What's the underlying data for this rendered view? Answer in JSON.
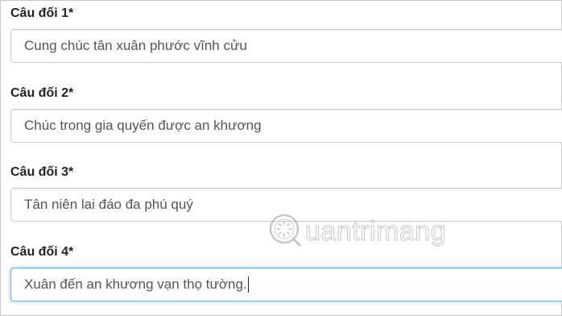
{
  "fields": [
    {
      "label": "Câu đối 1*",
      "value": "Cung chúc tân xuân phước vĩnh cửu"
    },
    {
      "label": "Câu đối 2*",
      "value": "Chúc trong gia quyến được an khương"
    },
    {
      "label": "Câu đối 3*",
      "value": "Tân niên lai đáo đa phú quý"
    },
    {
      "label": "Câu đối 4*",
      "value": "Xuân đến an khương vạn thọ tường."
    }
  ],
  "watermark": {
    "text": "uantrimang",
    "icon": "quantrimang-logo-icon"
  },
  "colors": {
    "label": "#222222",
    "input_text": "#555555",
    "input_border": "#cccccc",
    "focus_border": "#66afe9"
  }
}
